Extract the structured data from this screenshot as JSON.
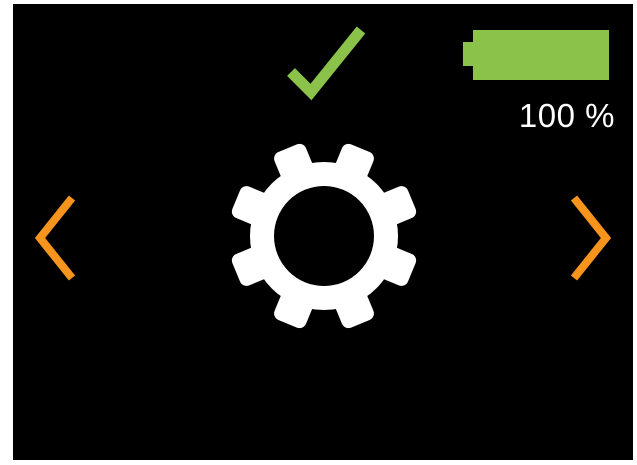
{
  "device": {
    "battery": {
      "level_percent": 100,
      "text": "100 %",
      "fill_color": "#8bc34a"
    },
    "status": {
      "icon": "checkmark-icon",
      "color": "#8bc34a"
    },
    "menu": {
      "current_item_icon": "gear-icon",
      "icon_color": "#ffffff"
    },
    "navigation": {
      "previous_icon": "chevron-left-icon",
      "next_icon": "chevron-right-icon",
      "color": "#f7941d"
    },
    "screen_background": "#000000"
  }
}
